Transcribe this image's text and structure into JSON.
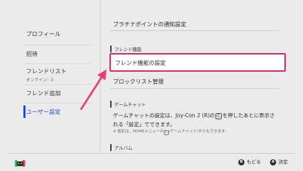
{
  "sidebar": {
    "items": [
      {
        "label": "プロフィール",
        "sub": ""
      },
      {
        "label": "招待",
        "sub": ""
      },
      {
        "label": "フレンドリスト",
        "sub": "オンライン：0"
      },
      {
        "label": "フレンド追加",
        "sub": ""
      },
      {
        "label": "ユーザー設定",
        "sub": ""
      }
    ],
    "selected_index": 4
  },
  "main": {
    "top_row": "プラチナポイントの通知設定",
    "friend_section": {
      "header": "フレンド機能",
      "items": [
        "フレンド機能の設定",
        "ブロックリスト管理"
      ]
    },
    "gamechat_section": {
      "header": "ゲームチャット",
      "desc_part1": "ゲームチャットの設定は、Joy-Con 2 (R)の",
      "desc_button": "C",
      "desc_part2": "を押したあとに表示される「設定」でできます。",
      "note_part1": "※ 設定は、HOMEメニューの",
      "note_button": "C",
      "note_part2": "(ゲームチャット)からもできます。"
    },
    "album_section": {
      "header": "アルバム"
    }
  },
  "footer": {
    "back": {
      "button": "B",
      "label": "もどる"
    },
    "confirm": {
      "button": "A",
      "label": "決定"
    }
  },
  "colors": {
    "accent_blue": "#1b46e5",
    "focus_pink": "#e4215a",
    "arrow_pink": "#ea3d72",
    "controller_left": "#2fbf4a",
    "controller_right": "#e63a3a"
  }
}
